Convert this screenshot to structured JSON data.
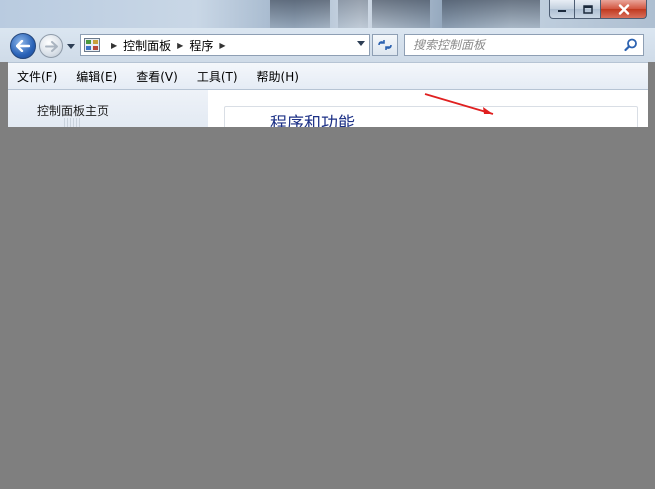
{
  "window": {
    "controls": {
      "minimize": "minimize-icon",
      "maximize": "maximize-icon",
      "close": "close-icon"
    }
  },
  "navigation": {
    "back_icon": "back-arrow-icon",
    "forward_icon": "forward-arrow-icon",
    "breadcrumbs": [
      "控制面板",
      "程序"
    ],
    "search": {
      "placeholder": "搜索控制面板",
      "icon": "search-icon"
    }
  },
  "menu": {
    "items": [
      "文件(F)",
      "编辑(E)",
      "查看(V)",
      "工具(T)",
      "帮助(H)"
    ]
  },
  "sidebar": {
    "home_link": "控制面板主页"
  },
  "main": {
    "section_title": "程序和功能"
  },
  "colors": {
    "accent_blue": "#2a63b8",
    "link_blue": "#1e3287",
    "close_red": "#c0391f",
    "annotation_arrow": "#e02020",
    "overlay_gray": "#7f7f7f"
  }
}
